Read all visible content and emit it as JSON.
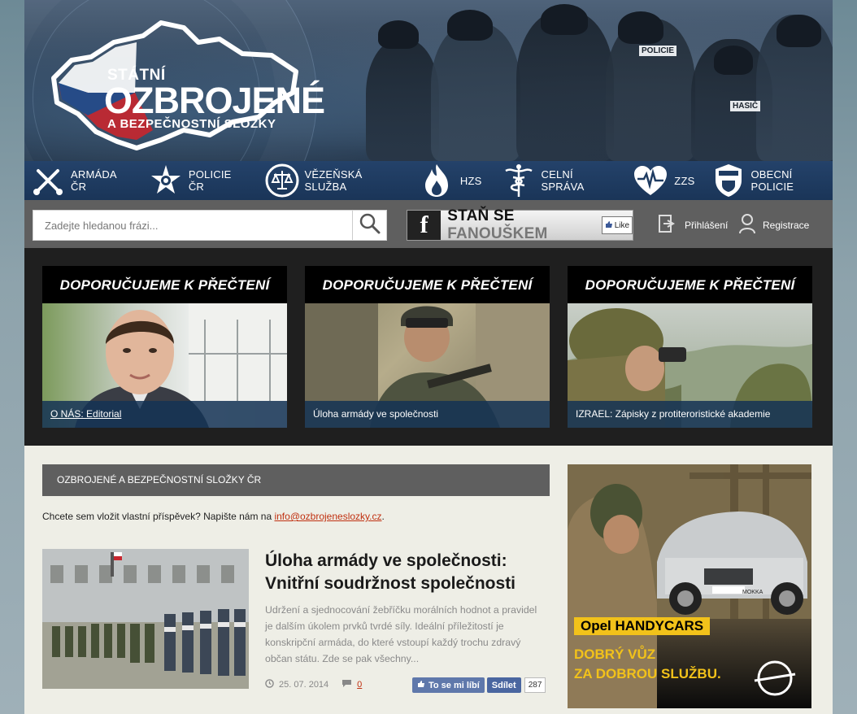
{
  "logo": {
    "line1": "STÁTNÍ",
    "line2": "OZBROJENÉ",
    "line3": "A BEZPEČNOSTNÍ SLOŽKY"
  },
  "banner": {
    "patch1": "POLICIE",
    "patch2": "HASIČ"
  },
  "nav": {
    "items": [
      {
        "label": "Armáda ČR",
        "icon": "swords-icon"
      },
      {
        "label": "Policie ČR",
        "icon": "police-star-icon"
      },
      {
        "label": "Vězeňská služba",
        "icon": "justice-scales-icon"
      },
      {
        "label": "HZS",
        "icon": "flame-icon"
      },
      {
        "label": "Celní správa",
        "icon": "caduceus-icon"
      },
      {
        "label": "ZZS",
        "icon": "heartbeat-icon"
      },
      {
        "label": "Obecní policie",
        "icon": "shield-badge-icon"
      }
    ]
  },
  "search": {
    "placeholder": "Zadejte hledanou frázi..."
  },
  "facebook": {
    "text_main": "STAŇ SE ",
    "text_accent": "FANOUŠKEM",
    "like": "Like"
  },
  "user": {
    "login": "Přihlášení",
    "register": "Registrace"
  },
  "featured": {
    "heading": "DOPORUČUJEME K PŘEČTENÍ",
    "cards": [
      {
        "caption": "O NÁS: Editorial"
      },
      {
        "caption": "Úloha armády ve společnosti"
      },
      {
        "caption": "IZRAEL: Zápisky z protiteroristické akademie"
      }
    ]
  },
  "section": {
    "title": "OZBROJENÉ A BEZPEČNOSTNÍ SLOŽKY ČR",
    "invite_text": "Chcete sem vložit vlastní příspěvek? Napište nám na ",
    "invite_email": "info@ozbrojeneslozky.cz",
    "invite_end": "."
  },
  "article": {
    "title": "Úloha armády ve společnosti: Vnitřní soudržnost společnosti",
    "excerpt": "Udržení a sjednocování žebříčku morálních hodnot a pravidel je dalším úkolem prvků tvrdé síly. Ideální příležitostí je konskripční armáda, do které vstoupí každý trochu zdravý občan státu. Zde se pak všechny...",
    "date": "25. 07. 2014",
    "comments": "0",
    "like_label": "To se mi líbí",
    "share_label": "Sdílet",
    "share_count": "287"
  },
  "ad": {
    "tag": "Opel HANDYCARS",
    "slogan_line1": "DOBRÝ VŮZ",
    "slogan_line2": "ZA DOBROU SLUŽBU.",
    "plate": "MOKKA"
  },
  "colors": {
    "nav_bg": "#1f3c62",
    "toolbar_bg": "#5f5f5f",
    "featured_bg": "#1f1f1f",
    "content_bg": "#eeeee6",
    "link": "#c03010",
    "ad_yellow": "#f2c21a"
  }
}
